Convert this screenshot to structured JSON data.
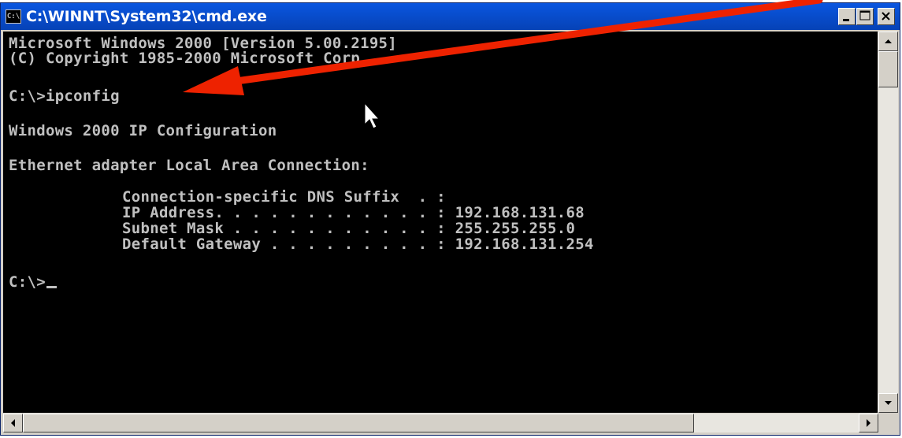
{
  "window": {
    "title": "C:\\WINNT\\System32\\cmd.exe",
    "icon_text": "C:\\",
    "icon": "console-icon",
    "buttons": {
      "minimize": "minimize-icon",
      "maximize": "maximize-icon",
      "close": "close-icon"
    }
  },
  "console": {
    "lines": [
      "Microsoft Windows 2000 [Version 5.00.2195]",
      "(C) Copyright 1985-2000 Microsoft Corp.",
      "C:\\>ipconfig",
      "Windows 2000 IP Configuration",
      "Ethernet adapter Local Area Connection:",
      "Connection-specific DNS Suffix  . :",
      "IP Address. . . . . . . . . . . . : 192.168.131.68",
      "Subnet Mask . . . . . . . . . . . : 255.255.255.0",
      "Default Gateway . . . . . . . . . : 192.168.131.254",
      "C:\\>"
    ],
    "text_color": "#c0c0c0",
    "background": "#000000"
  },
  "annotation": {
    "arrow_color": "#ee2200",
    "arrow": "red-arrow-annotation",
    "pointer": "mouse-pointer-icon"
  },
  "scrollbars": {
    "up": "scroll-up-arrow-icon",
    "down": "scroll-down-arrow-icon",
    "left": "scroll-left-arrow-icon",
    "right": "scroll-right-arrow-icon"
  },
  "theme": {
    "titlebar": "#0a56e0",
    "chrome": "#d4d0c8"
  }
}
